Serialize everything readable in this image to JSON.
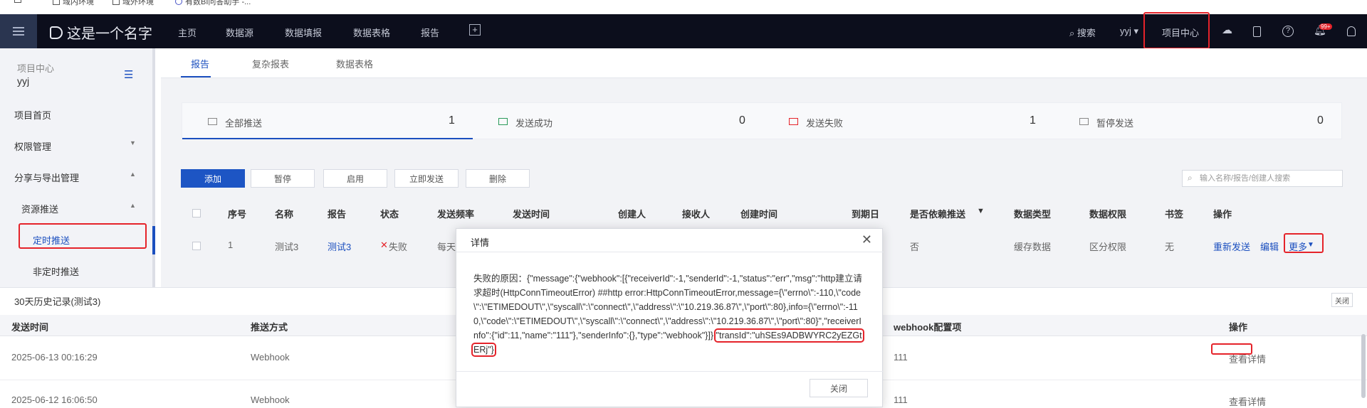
{
  "bookmarks": [
    "",
    "域内环境",
    "域外环境",
    "有数BI问答助手 -..."
  ],
  "topnav": {
    "logo": "这是一个名字",
    "items": [
      "主页",
      "数据源",
      "数据填报",
      "数据表格",
      "报告"
    ],
    "search": "搜索",
    "user": "yyj",
    "project_center": "项目中心",
    "badge": "99+"
  },
  "sidebar": {
    "section": "项目中心",
    "user": "yyj",
    "items": [
      "项目首页",
      "权限管理",
      "分享与导出管理",
      "资源推送",
      "定时推送",
      "非定时推送"
    ]
  },
  "tabs": [
    "报告",
    "复杂报表",
    "数据表格"
  ],
  "stats": [
    {
      "label": "全部推送",
      "value": "1"
    },
    {
      "label": "发送成功",
      "value": "0"
    },
    {
      "label": "发送失败",
      "value": "1"
    },
    {
      "label": "暂停发送",
      "value": "0"
    }
  ],
  "toolbar": {
    "buttons": [
      "添加",
      "暂停",
      "启用",
      "立即发送",
      "删除"
    ],
    "search_placeholder": "输入名称/报告/创建人搜索"
  },
  "table": {
    "headers": [
      "序号",
      "名称",
      "报告",
      "状态",
      "发送频率",
      "发送时间",
      "创建人",
      "接收人",
      "创建时间",
      "到期日",
      "是否依赖推送",
      "数据类型",
      "数据权限",
      "书签",
      "操作"
    ],
    "row": {
      "index": "1",
      "name": "测试3",
      "report": "测试3",
      "status": "失败",
      "frequency": "每天",
      "depend": "否",
      "data_type": "缓存数据",
      "permission": "区分权限",
      "bookmark": "无",
      "actions": [
        "重新发送",
        "编辑",
        "更多"
      ]
    }
  },
  "history": {
    "title": "30天历史记录(测试3)",
    "close": "关闭",
    "headers": [
      "发送时间",
      "推送方式",
      "webhook配置项",
      "操作"
    ],
    "rows": [
      {
        "time": "2025-06-13 00:16:29",
        "method": "Webhook",
        "config": "111",
        "action": "查看详情"
      },
      {
        "time": "2025-06-12 16:06:50",
        "method": "Webhook",
        "config": "111",
        "action": "查看详情"
      }
    ]
  },
  "modal": {
    "title": "详情",
    "body_main": "失败的原因：{\"message\":{\"webhook\":[{\"receiverId\":-1,\"senderId\":-1,\"status\":\"err\",\"msg\":\"http建立请求超时(HttpConnTimeoutError) ##http error:HttpConnTimeoutError,message={\\\"errno\\\":-110,\\\"code\\\":\\\"ETIMEDOUT\\\",\\\"syscall\\\":\\\"connect\\\",\\\"address\\\":\\\"10.219.36.87\\\",\\\"port\\\":80},info={\\\"errno\\\":-110,\\\"code\\\":\\\"ETIMEDOUT\\\",\\\"syscall\\\":\\\"connect\\\",\\\"address\\\":\\\"10.219.36.87\\\",\\\"port\\\":80}\",\"receiverInfo\":{\"id\":11,\"name\":\"111\"},\"senderInfo\":{},\"type\":\"webhook\"}]},",
    "body_transid": "\"transId\":\"uhSEs9ADBWYRC2yEZGtERj\"}",
    "close": "关闭"
  },
  "colors": {
    "accent": "#1b4fbf",
    "highlight": "#e5232a",
    "nav_bg": "#0c0e1c"
  }
}
